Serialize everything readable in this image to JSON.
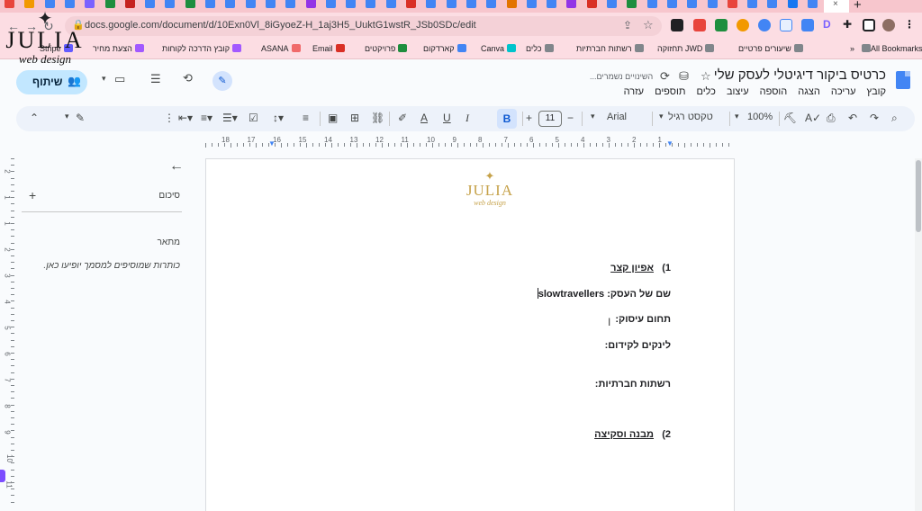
{
  "browser": {
    "url": "docs.google.com/document/d/10Exn0Vl_8iGyoeZ-H_1aj3H5_UuktG1wstR_JSb0SDc/edit",
    "tab_colors": [
      "#e8453c",
      "#f29900",
      "#4285f4",
      "#4285f4",
      "#7b61ff",
      "#1e8e3e",
      "#c5221f",
      "#4285f4",
      "#4285f4",
      "#1e8e3e",
      "#4285f4",
      "#4285f4",
      "#4285f4",
      "#4285f4",
      "#4285f4",
      "#9334e6",
      "#4285f4",
      "#4285f4",
      "#4285f4",
      "#4285f4",
      "#d93025",
      "#4285f4",
      "#4285f4",
      "#4285f4",
      "#4285f4",
      "#e37400",
      "#4285f4",
      "#4285f4",
      "#9334e6",
      "#d93025",
      "#4285f4",
      "#1e8e3e",
      "#4285f4",
      "#4285f4",
      "#4285f4",
      "#4285f4",
      "#e8453c",
      "#4285f4",
      "#4285f4",
      "#1877f2",
      "#4285f4"
    ]
  },
  "bookmarks": {
    "all": "All Bookmarks",
    "items": [
      {
        "label": "שיעורים פרטיים",
        "color": "#80868b"
      },
      {
        "label": "JWD תחזוקה",
        "color": "#80868b"
      },
      {
        "label": "רשתות חברתיות",
        "color": "#80868b"
      },
      {
        "label": "כלים",
        "color": "#80868b"
      },
      {
        "label": "Canva",
        "color": "#00c4cc"
      },
      {
        "label": "קארדקום",
        "color": "#4285f4"
      },
      {
        "label": "פרויקטים",
        "color": "#1e8e3e"
      },
      {
        "label": "Email",
        "color": "#d93025"
      },
      {
        "label": "ASANA",
        "color": "#f06a6a"
      },
      {
        "label": "קובץ הדרכה לקוחות",
        "color": "#a259ff"
      },
      {
        "label": "הצעת מחיר",
        "color": "#a259ff"
      },
      {
        "label": "Stripe",
        "color": "#635bff"
      }
    ]
  },
  "docs": {
    "title": "כרטיס ביקור דיגיטלי לעסק שלי",
    "saving": "השינויים נשמרים...",
    "share": "שיתוף",
    "menu": [
      "קובץ",
      "עריכה",
      "הצגה",
      "הוספה",
      "עיצוב",
      "כלים",
      "תוספים",
      "עזרה"
    ]
  },
  "toolbar": {
    "zoom": "100%",
    "style": "טקסט רגיל",
    "font": "Arial",
    "font_size": "11"
  },
  "ruler": {
    "numbers": [
      "18",
      "17",
      "16",
      "15",
      "14",
      "13",
      "12",
      "11",
      "10",
      "9",
      "8",
      "7",
      "6",
      "5",
      "4",
      "3",
      "2",
      "1"
    ],
    "vnumbers": [
      "2",
      "1",
      "1",
      "2",
      "3",
      "4",
      "5",
      "6",
      "7",
      "8",
      "9",
      "10",
      "11"
    ]
  },
  "outline": {
    "summary": "סיכום",
    "heading": "מתאר",
    "empty": "כותרות שמוסיפים למסמך יופיעו כאן."
  },
  "document": {
    "logo_text": "JULIA",
    "logo_sub": "web design",
    "h1_num": "1)",
    "h1": "אפיון קצר",
    "business_label": "שם של העסק:",
    "business_value": "slowtravellers",
    "field_label": "תחום עיסוק:",
    "links_label": "לינקים לקידום:",
    "social_label": "רשתות חברתיות:",
    "h2_num": "2)",
    "h2": "מבנה וסקיצה"
  },
  "watermark": {
    "text": "JULIA",
    "sub": "web design"
  }
}
